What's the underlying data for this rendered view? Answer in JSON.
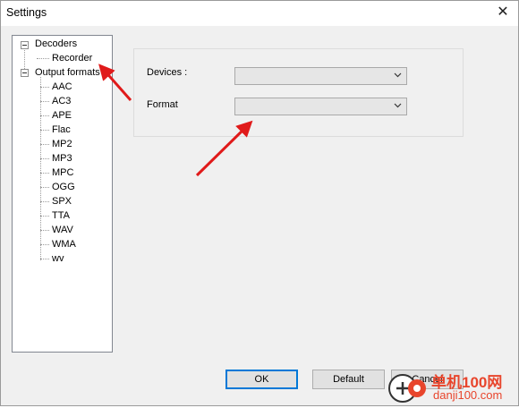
{
  "window": {
    "title": "Settings",
    "close_glyph": "✕"
  },
  "tree": {
    "decoders": {
      "label": "Decoders",
      "children": [
        "Recorder"
      ]
    },
    "output_formats": {
      "label": "Output formats",
      "children": [
        "AAC",
        "AC3",
        "APE",
        "Flac",
        "MP2",
        "MP3",
        "MPC",
        "OGG",
        "SPX",
        "TTA",
        "WAV",
        "WMA",
        "wv"
      ]
    }
  },
  "form": {
    "devices_label": "Devices :",
    "devices_value": "",
    "format_label": "Format",
    "format_value": ""
  },
  "buttons": {
    "ok": "OK",
    "default": "Default",
    "cancel": "Cancel"
  },
  "watermark": {
    "text": "单机100网",
    "url": "danji100.com"
  },
  "colors": {
    "arrow": "#e01a1a",
    "accent": "#0078d7",
    "watermark": "#e8452c"
  }
}
